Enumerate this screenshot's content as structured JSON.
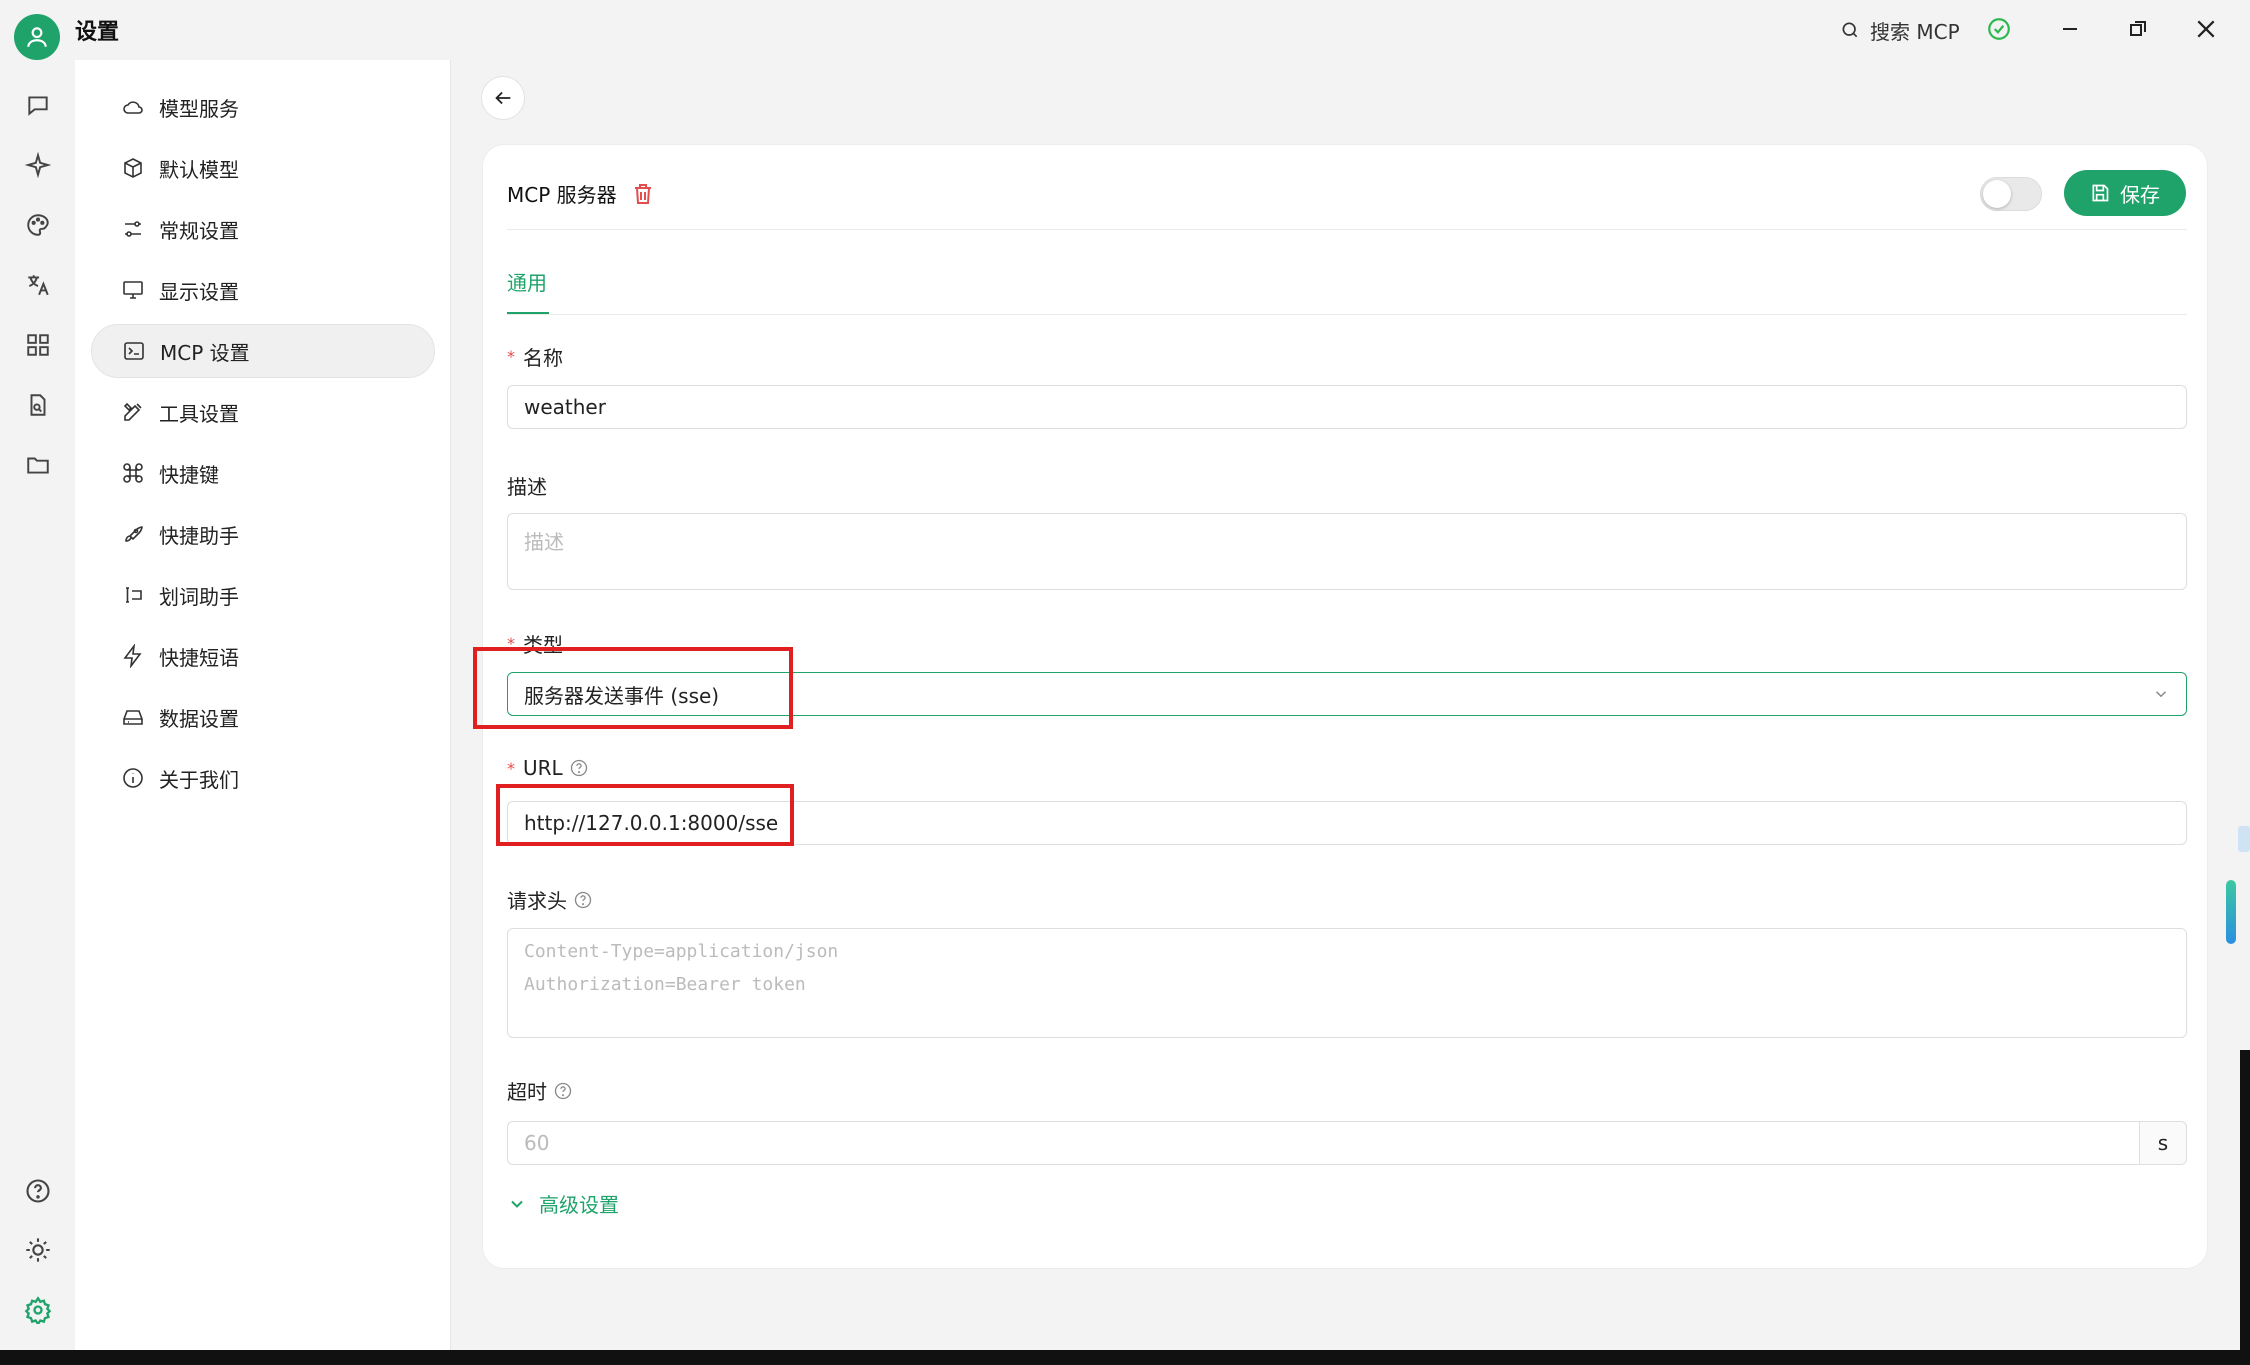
{
  "titlebar": {
    "app_title": "设置",
    "search_label": "搜索 MCP"
  },
  "sidebar": {
    "items": [
      {
        "label": "模型服务",
        "icon": "cloud-icon"
      },
      {
        "label": "默认模型",
        "icon": "cube-icon"
      },
      {
        "label": "常规设置",
        "icon": "sliders-icon"
      },
      {
        "label": "显示设置",
        "icon": "monitor-icon"
      },
      {
        "label": "MCP 设置",
        "icon": "terminal-icon",
        "active": true
      },
      {
        "label": "工具设置",
        "icon": "tools-icon"
      },
      {
        "label": "快捷键",
        "icon": "command-icon"
      },
      {
        "label": "快捷助手",
        "icon": "rocket-icon"
      },
      {
        "label": "划词助手",
        "icon": "text-select-icon"
      },
      {
        "label": "快捷短语",
        "icon": "zap-icon"
      },
      {
        "label": "数据设置",
        "icon": "hard-drive-icon"
      },
      {
        "label": "关于我们",
        "icon": "info-icon"
      }
    ]
  },
  "card": {
    "title": "MCP 服务器",
    "save_label": "保存",
    "enabled": false,
    "tab": "通用",
    "fields": {
      "name": {
        "label": "名称",
        "value": "weather"
      },
      "description": {
        "label": "描述",
        "placeholder": "描述"
      },
      "type": {
        "label": "类型",
        "value": "服务器发送事件 (sse)"
      },
      "url": {
        "label": "URL",
        "value": "http://127.0.0.1:8000/sse"
      },
      "headers": {
        "label": "请求头",
        "placeholder_line1": "Content-Type=application/json",
        "placeholder_line2": "Authorization=Bearer token"
      },
      "timeout": {
        "label": "超时",
        "placeholder": "60",
        "unit": "s"
      }
    },
    "advanced_label": "高级设置"
  },
  "colors": {
    "accent": "#1fa36b",
    "highlight": "#e02020",
    "danger": "#e34d4d"
  }
}
